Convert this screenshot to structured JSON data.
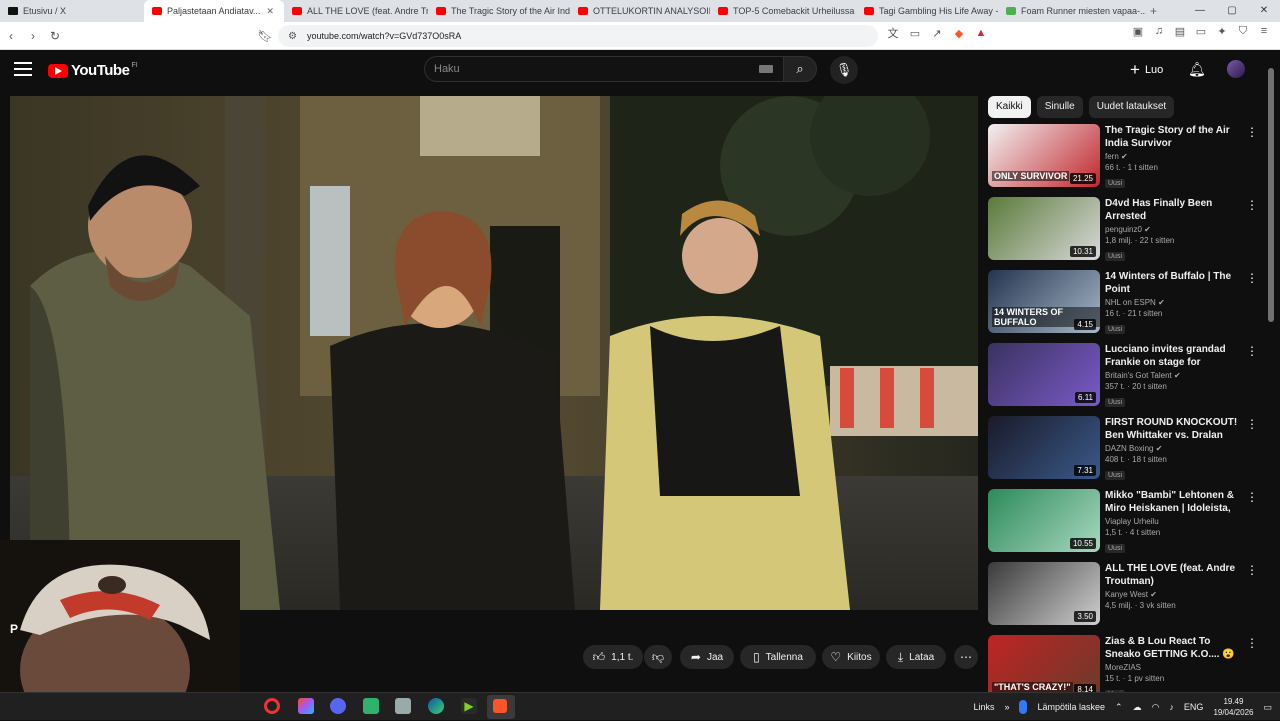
{
  "browser": {
    "tabs": [
      {
        "title": "Etusivu / X",
        "icon": "x-logo-icon"
      },
      {
        "title": "Paljastetaan Andiatav...",
        "icon": "youtube-icon",
        "active": true
      },
      {
        "title": "ALL THE LOVE (feat. Andre Tro...",
        "icon": "youtube-icon"
      },
      {
        "title": "The Tragic Story of the Air Indi...",
        "icon": "youtube-icon"
      },
      {
        "title": "OTTELUKORTIN ANALYSOINTI ...",
        "icon": "youtube-icon"
      },
      {
        "title": "TOP-5 Comebackit Urheilussa ...",
        "icon": "youtube-icon"
      },
      {
        "title": "Tagi Gambling His Life Away -",
        "icon": "youtube-icon"
      },
      {
        "title": "Foam Runner miesten vapaa-...",
        "icon": "shop-icon"
      }
    ],
    "url": "youtube.com/watch?v=GVd737O0sRA"
  },
  "youtube": {
    "logo_text": "YouTube",
    "region": "FI",
    "search_placeholder": "Haku",
    "create_label": "Luo"
  },
  "actions": {
    "likes": "1,1 t.",
    "share": "Jaa",
    "save": "Tallenna",
    "thanks": "Kiitos",
    "download": "Lataa"
  },
  "chips": [
    "Kaikki",
    "Sinulle",
    "Uudet lataukset"
  ],
  "recommendations": [
    {
      "title": "The Tragic Story of the Air India Survivor",
      "channel": "fern",
      "stats": "66 t. · 1 t sitten",
      "badge": "Uusi",
      "duration": "21.25",
      "overlay": "ONLY SURVIVOR",
      "verified": true
    },
    {
      "title": "D4vd Has Finally Been Arrested",
      "channel": "penguinz0",
      "stats": "1,8 milj. · 22 t sitten",
      "badge": "Uusi",
      "duration": "10.31",
      "overlay": "",
      "verified": true
    },
    {
      "title": "14 Winters of Buffalo | The Point",
      "channel": "NHL on ESPN",
      "stats": "16 t. · 21 t sitten",
      "badge": "Uusi",
      "duration": "4.15",
      "overlay": "14 WINTERS OF BUFFALO",
      "verified": true
    },
    {
      "title": "Lucciano invites grandad Frankie on stage for emotiona...",
      "channel": "Britain's Got Talent",
      "stats": "357 t. · 20 t sitten",
      "badge": "Uusi",
      "duration": "6.11",
      "overlay": "",
      "verified": true
    },
    {
      "title": "FIRST ROUND KNOCKOUT! Ben Whittaker vs. Dralan Suarez | ...",
      "channel": "DAZN Boxing",
      "stats": "408 t. · 18 t sitten",
      "badge": "Uusi",
      "duration": "7.31",
      "overlay": "",
      "verified": true
    },
    {
      "title": "Mikko \"Bambi\" Lehtonen & Miro Heiskanen | Idoleista, urasta &...",
      "channel": "Viaplay Urheilu",
      "stats": "1,5 t. · 4 t sitten",
      "badge": "Uusi",
      "duration": "10.55",
      "overlay": "",
      "verified": false
    },
    {
      "title": "ALL THE LOVE (feat. Andre Troutman)",
      "channel": "Kanye West",
      "stats": "4,5 milj. · 3 vk sitten",
      "badge": "",
      "duration": "3.50",
      "overlay": "",
      "verified": true
    },
    {
      "title": "Zias & B Lou React To Sneako GETTING K.O.... 😮😮",
      "channel": "MoreZIAS",
      "stats": "15 t. · 1 pv sitten",
      "badge": "Uusi",
      "duration": "8.14",
      "overlay": "\"THAT'S CRAZY!\"",
      "verified": false
    }
  ],
  "taskbar": {
    "links": "Links",
    "weather": "Lämpötila laskee",
    "lang": "ENG",
    "time": "19.49",
    "date": "19/04/2026"
  },
  "colors": {
    "youtube_red": "#ff0000",
    "background": "#0f0f0f",
    "chip_bg": "#272727"
  }
}
